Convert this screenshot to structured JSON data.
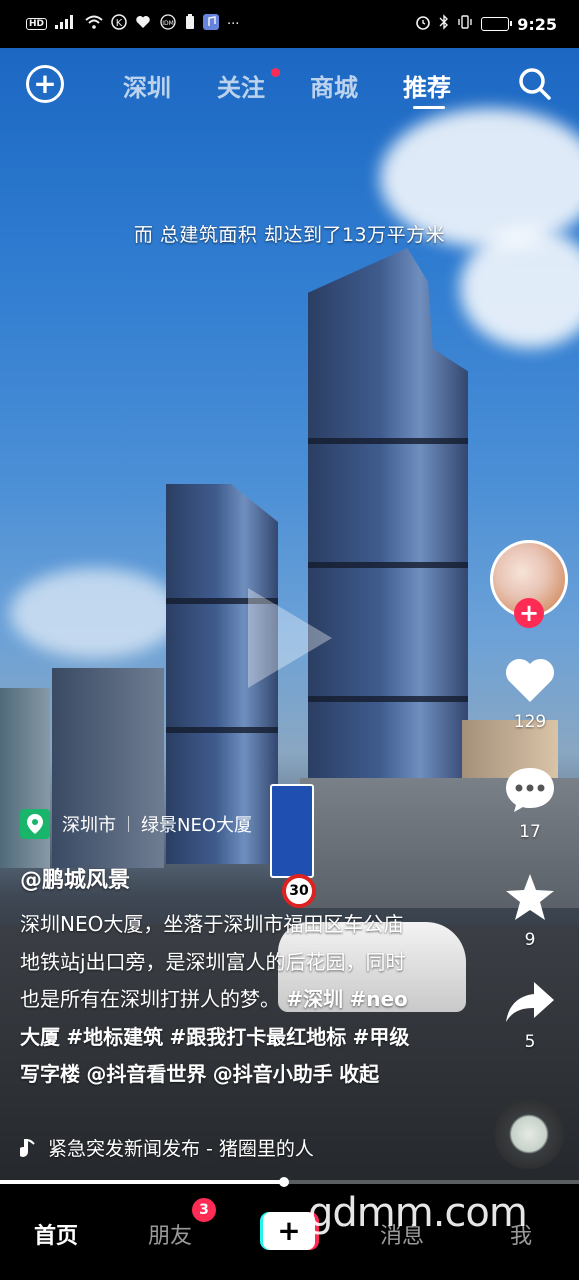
{
  "status_bar": {
    "left_icons": [
      "HD",
      "5G signal",
      "wifi",
      "K",
      "heart",
      "IDM",
      "battery-saver",
      "music-app",
      "..."
    ],
    "hd": "HD",
    "more": "···",
    "time": "9:25",
    "battery_level": 0.35
  },
  "top_nav": {
    "tabs": [
      "深圳",
      "关注",
      "商城",
      "推荐"
    ],
    "active_tab": "推荐"
  },
  "video": {
    "subtitle": "而 总建筑面积 却达到了13万平方米",
    "speed_limit": "30"
  },
  "right_rail": {
    "likes": "129",
    "comments": "17",
    "favorites": "9",
    "shares": "5"
  },
  "post": {
    "location_city": "深圳市",
    "location_place": "绿景NEO大厦",
    "author": "@鹏城风景",
    "caption_text": "深圳NEO大厦，坐落于深圳市福田区车公庙地铁站j出口旁，是深圳富人的后花园，同时也是所有在深圳打拼人的梦。",
    "tags": [
      "#深圳",
      "#neo大厦",
      "#地标建筑",
      "#跟我打卡最红地标",
      "#甲级写字楼"
    ],
    "mentions": [
      "@抖音看世界",
      "@抖音小助手"
    ],
    "collapse": "收起",
    "music": "紧急突发新闻发布 - 猪圈里的人"
  },
  "progress": 0.49,
  "tab_bar": {
    "home": "首页",
    "friends": "朋友",
    "friends_badge": "3",
    "messages": "消息",
    "me": "我"
  },
  "watermark": "gdmm.com",
  "colors": {
    "accent": "#fe2c55",
    "cyan": "#25f4ee",
    "location_green": "#18b56a"
  }
}
